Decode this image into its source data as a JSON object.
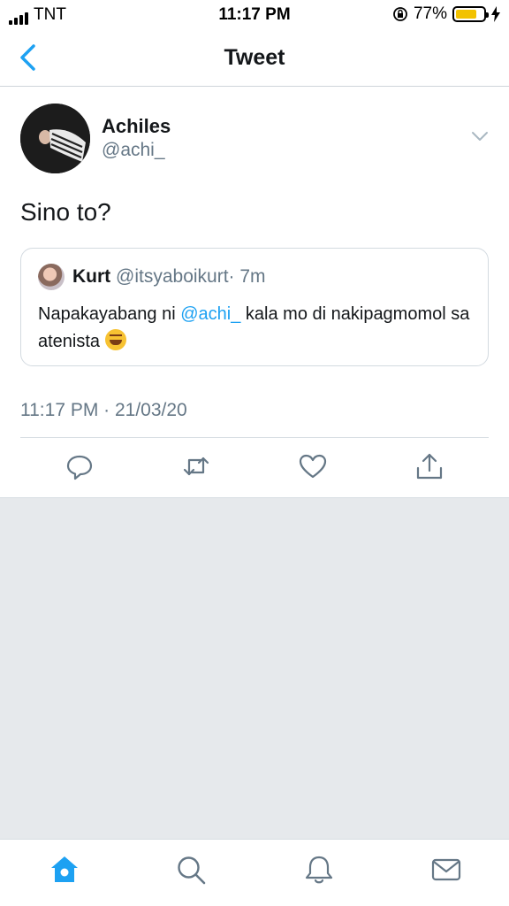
{
  "status_bar": {
    "carrier": "TNT",
    "time": "11:17 PM",
    "battery_percent": "77%",
    "battery_level": 0.77,
    "battery_color": "#f2c200"
  },
  "nav": {
    "title": "Tweet",
    "back_icon": "chevron-left-icon"
  },
  "tweet": {
    "author_name": "Achiles",
    "author_handle": "@achi_",
    "text": "Sino to?",
    "timestamp": "11:17 PM · 21/03/20",
    "quoted": {
      "name": "Kurt",
      "handle": "@itsyaboikurt",
      "age": "· 7m",
      "text_before": "Napakayabang ni ",
      "mention": "@achi_",
      "text_after": " kala mo di nakipagmomol sa atenista "
    }
  },
  "actions": [
    "reply-icon",
    "retweet-icon",
    "like-icon",
    "share-icon"
  ],
  "tabs": [
    "home-icon",
    "search-icon",
    "notifications-icon",
    "messages-icon"
  ],
  "colors": {
    "accent": "#1da1f2",
    "secondary_text": "#657786",
    "background_gray": "#e6e9ec"
  }
}
